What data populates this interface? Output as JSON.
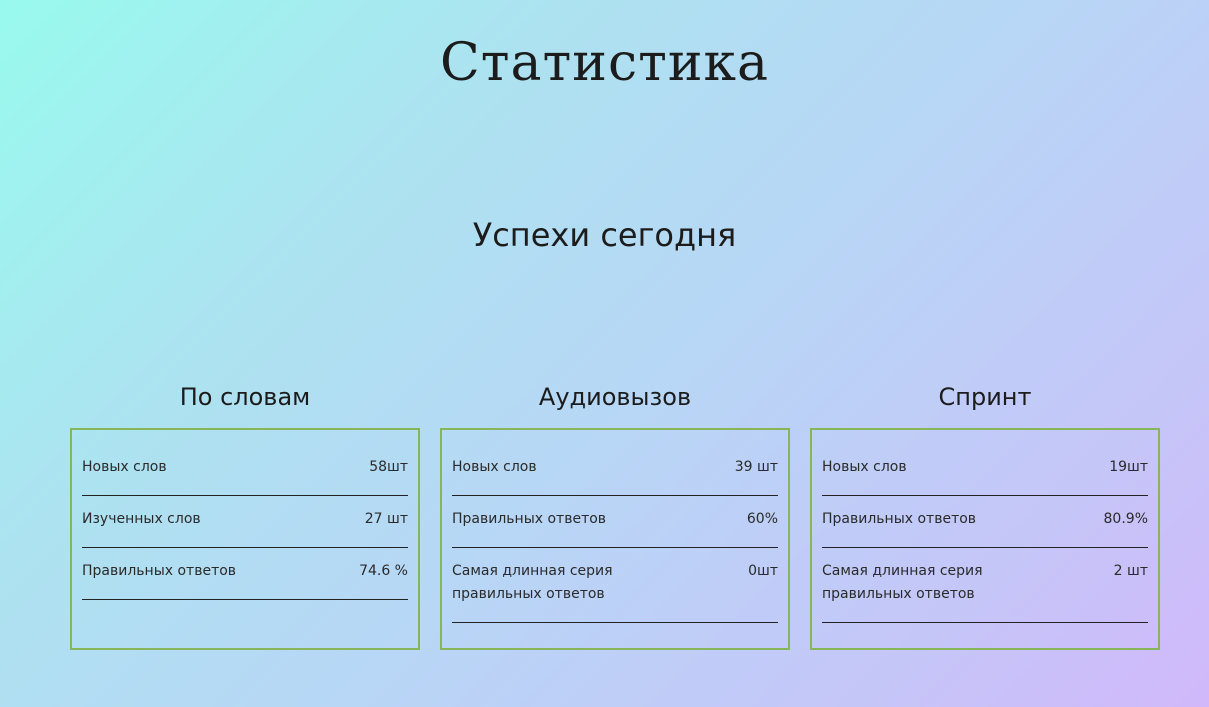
{
  "page": {
    "title": "Статистика",
    "subtitle": "Успехи сегодня"
  },
  "colors": {
    "card_border": "#86b55a",
    "gradient_start": "#98faee",
    "gradient_end": "#d1b8fa"
  },
  "cards": [
    {
      "title": "По словам",
      "rows": [
        {
          "label": "Новых слов",
          "value": "58шт"
        },
        {
          "label": "Изученных слов",
          "value": "27 шт"
        },
        {
          "label": "Правильных ответов",
          "value": "74.6 %"
        }
      ]
    },
    {
      "title": "Аудиовызов",
      "rows": [
        {
          "label": "Новых слов",
          "value": "39 шт"
        },
        {
          "label": "Правильных ответов",
          "value": "60%"
        },
        {
          "label": "Самая длинная серия правильных ответов",
          "value": "0шт"
        }
      ]
    },
    {
      "title": "Спринт",
      "rows": [
        {
          "label": "Новых слов",
          "value": "19шт"
        },
        {
          "label": "Правильных ответов",
          "value": "80.9%"
        },
        {
          "label": "Самая длинная серия правильных ответов",
          "value": "2 шт"
        }
      ]
    }
  ]
}
